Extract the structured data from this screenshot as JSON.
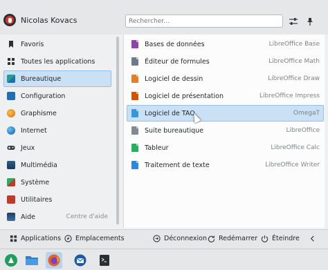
{
  "header": {
    "username": "Nicolas Kovacs",
    "search_placeholder": "Rechercher...",
    "config_icon": "sliders-icon",
    "pin_icon": "pin-icon"
  },
  "sidebar": {
    "items": [
      {
        "label": "Favoris",
        "icon": "bookmark-icon",
        "color": "#2d2f31"
      },
      {
        "label": "Toutes les applications",
        "icon": "grid-icon",
        "color": "#31363b"
      },
      {
        "label": "Bureautique",
        "icon": "office-icon",
        "color": "#2a9d8f",
        "active": true
      },
      {
        "label": "Configuration",
        "icon": "config-icon",
        "color": "#1e6fb8"
      },
      {
        "label": "Graphisme",
        "icon": "graphics-icon",
        "color": "#f08a24"
      },
      {
        "label": "Internet",
        "icon": "globe-icon",
        "color": "#2b7bc4"
      },
      {
        "label": "Jeux",
        "icon": "gamepad-icon",
        "color": "#3c4046"
      },
      {
        "label": "Multimédia",
        "icon": "multimedia-icon",
        "color": "#2a5e8c"
      },
      {
        "label": "Système",
        "icon": "system-icon",
        "color": "#27ae60"
      },
      {
        "label": "Utilitaires",
        "icon": "utilities-icon",
        "color": "#c0392b"
      },
      {
        "label": "Aide",
        "icon": "help-icon",
        "color": "#1f3b63"
      }
    ],
    "help_hint": "Centre d'aide"
  },
  "apps": [
    {
      "name": "Bases de données",
      "generic": "LibreOffice Base",
      "color": "#8e44ad"
    },
    {
      "name": "Éditeur de formules",
      "generic": "LibreOffice Math",
      "color": "#6c7a89"
    },
    {
      "name": "Logiciel de dessin",
      "generic": "LibreOffice Draw",
      "color": "#e67e22"
    },
    {
      "name": "Logiciel de présentation",
      "generic": "LibreOffice Impress",
      "color": "#d35400"
    },
    {
      "name": "Logiciel de TAO",
      "generic": "OmegaT",
      "color": "#3498db",
      "active": true
    },
    {
      "name": "Suite bureautique",
      "generic": "LibreOffice",
      "color": "#7f8c8d"
    },
    {
      "name": "Tableur",
      "generic": "LibreOffice Calc",
      "color": "#27ae60"
    },
    {
      "name": "Traitement de texte",
      "generic": "LibreOffice Writer",
      "color": "#2e86de"
    }
  ],
  "footer": {
    "applications": "Applications",
    "emplacements": "Emplacements",
    "deconnexion": "Déconnexion",
    "redemarrer": "Redémarrer",
    "eteindre": "Éteindre"
  },
  "taskbar": {
    "items": [
      "app-launcher-icon",
      "file-manager-icon",
      "firefox-icon",
      "thunderbird-icon",
      "terminal-icon"
    ]
  },
  "colors": {
    "accent": "#3daee9",
    "selection": "#c9e0f5"
  }
}
